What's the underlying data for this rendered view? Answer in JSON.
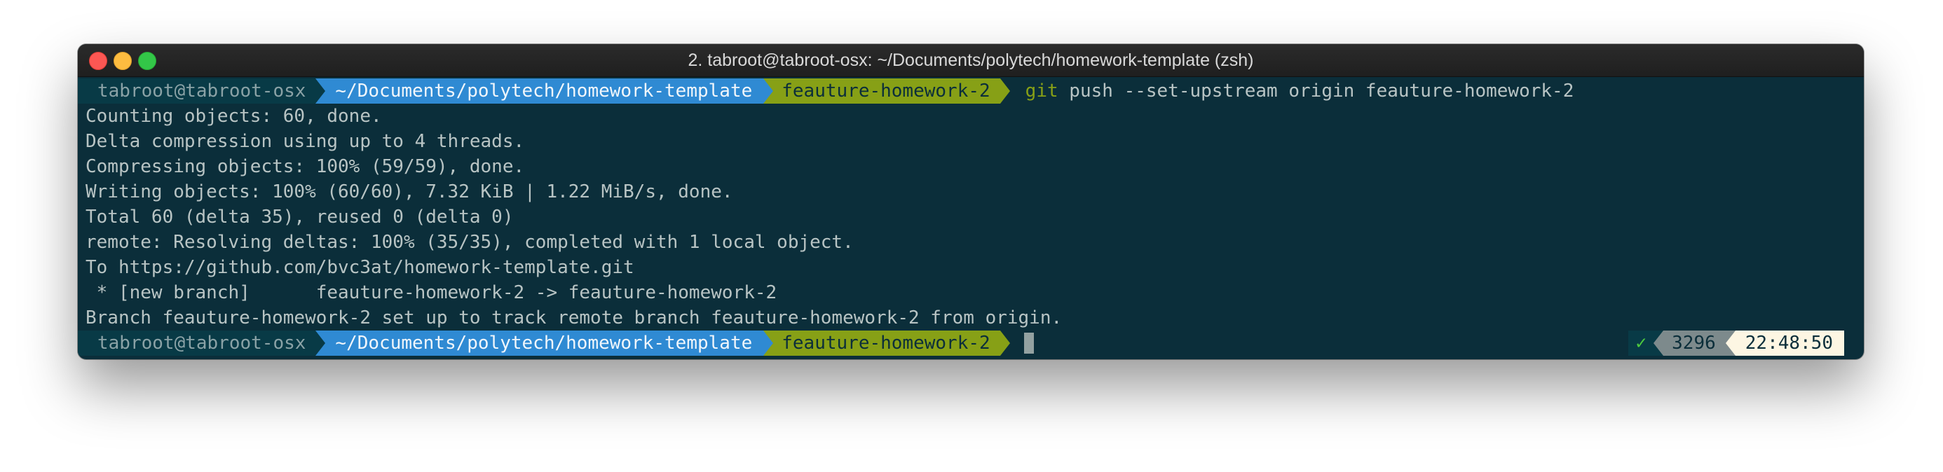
{
  "window": {
    "title": "2. tabroot@tabroot-osx: ~/Documents/polytech/homework-template (zsh)"
  },
  "prompt": {
    "user": "tabroot@tabroot-osx",
    "directory": "~/Documents/polytech/homework-template",
    "branch_icon": "",
    "branch": "feauture-homework-2"
  },
  "command": {
    "program": "git",
    "args": "push --set-upstream origin feauture-homework-2"
  },
  "output": [
    "Counting objects: 60, done.",
    "Delta compression using up to 4 threads.",
    "Compressing objects: 100% (59/59), done.",
    "Writing objects: 100% (60/60), 7.32 KiB | 1.22 MiB/s, done.",
    "Total 60 (delta 35), reused 0 (delta 0)",
    "remote: Resolving deltas: 100% (35/35), completed with 1 local object.",
    "To https://github.com/bvc3at/homework-template.git",
    " * [new branch]      feauture-homework-2 -> feauture-homework-2",
    "Branch feauture-homework-2 set up to track remote branch feauture-homework-2 from origin."
  ],
  "right_prompt": {
    "status": "✓",
    "history_number": "3296",
    "time": "22:48:50"
  },
  "colors": {
    "background": "#0b2e3a",
    "user_segment": "#083a46",
    "dir_segment": "#2f8ad3",
    "git_segment": "#87a016",
    "status_ok": "#4ecb3e"
  }
}
